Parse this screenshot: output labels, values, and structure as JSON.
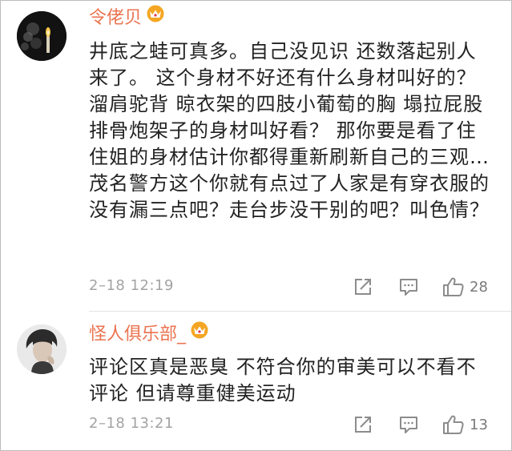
{
  "comments": [
    {
      "username": "令佬贝",
      "text": "井底之蛙可真多。自己没见识 还数落起别人来了。 这个身材不好还有什么身材叫好的？溜肩驼背 晾衣架的四肢小葡萄的胸 塌拉屁股 排骨炮架子的身材叫好看？ 那你要是看了住住姐的身材估计你都得重新刷新自己的三观…茂名警方这个你就有点过了人家是有穿衣服的没有漏三点吧？走台步没干别的吧？叫色情？",
      "time": "2–18 12:19",
      "likes": "28",
      "badge_icon": "crown-vip-icon"
    },
    {
      "username": "怪人俱乐部_",
      "text": "评论区真是恶臭 不符合你的审美可以不看不评论 但请尊重健美运动",
      "time": "2–18 13:21",
      "likes": "13",
      "badge_icon": "crown-vip-icon"
    }
  ],
  "colors": {
    "username": "#eb7350",
    "meta": "#a3a3a3",
    "icon": "#8c8c8c",
    "crown": "#f4a623"
  }
}
